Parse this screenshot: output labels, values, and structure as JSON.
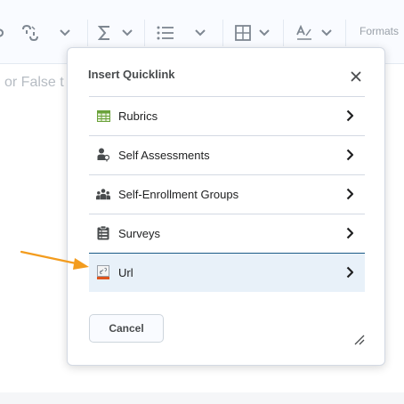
{
  "toolbar": {
    "formats_label": "Formats"
  },
  "editor": {
    "placeholder_fragment": "or False t"
  },
  "dialog": {
    "title": "Insert Quicklink",
    "items": [
      {
        "label": "Rubrics",
        "icon": "rubrics-grid-icon"
      },
      {
        "label": "Self Assessments",
        "icon": "self-assessment-icon"
      },
      {
        "label": "Self-Enrollment Groups",
        "icon": "groups-icon"
      },
      {
        "label": "Surveys",
        "icon": "survey-clipboard-icon"
      },
      {
        "label": "Url",
        "icon": "url-link-icon",
        "selected": true
      }
    ],
    "cancel_label": "Cancel"
  },
  "colors": {
    "selected_row_bg": "#e8f1f9",
    "selected_row_border": "#1a5a86",
    "annotation_arrow": "#f39c1e",
    "rubrics_icon": "#6aa23a",
    "url_icon_accent": "#e0541c"
  }
}
